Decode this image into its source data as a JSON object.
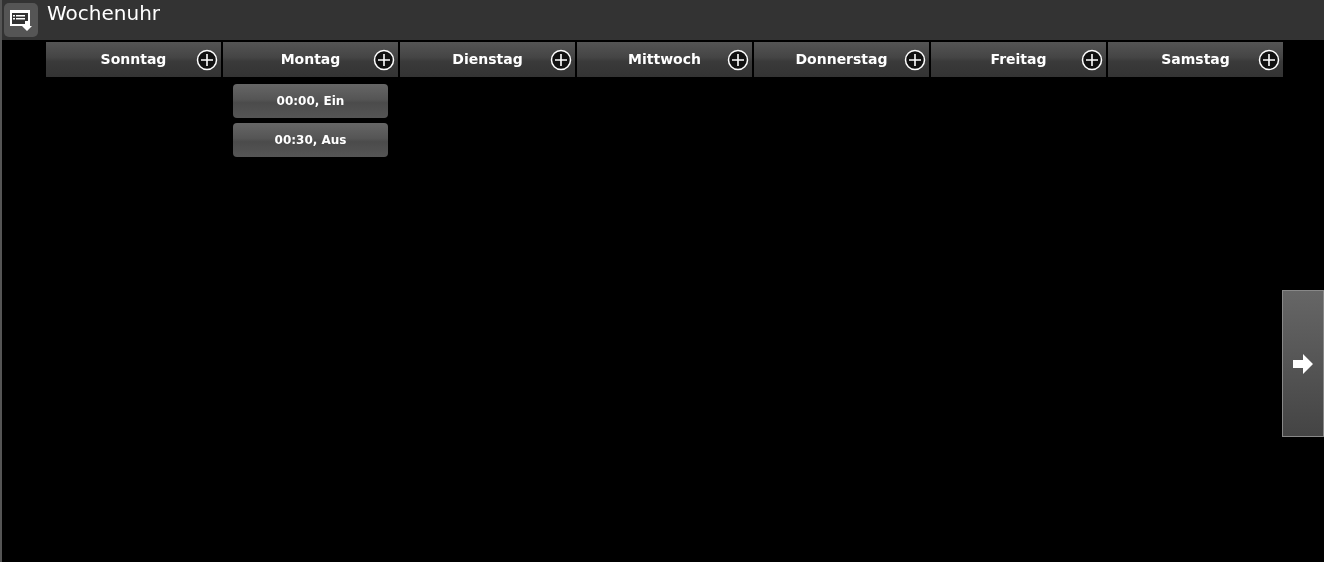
{
  "window": {
    "title": "Wochenuhr"
  },
  "days": [
    {
      "name": "Sonntag"
    },
    {
      "name": "Montag",
      "entries": [
        {
          "label": "00:00, Ein"
        },
        {
          "label": "00:30, Aus"
        }
      ]
    },
    {
      "name": "Dienstag"
    },
    {
      "name": "Mittwoch"
    },
    {
      "name": "Donnerstag"
    },
    {
      "name": "Freitag"
    },
    {
      "name": "Samstag"
    }
  ]
}
